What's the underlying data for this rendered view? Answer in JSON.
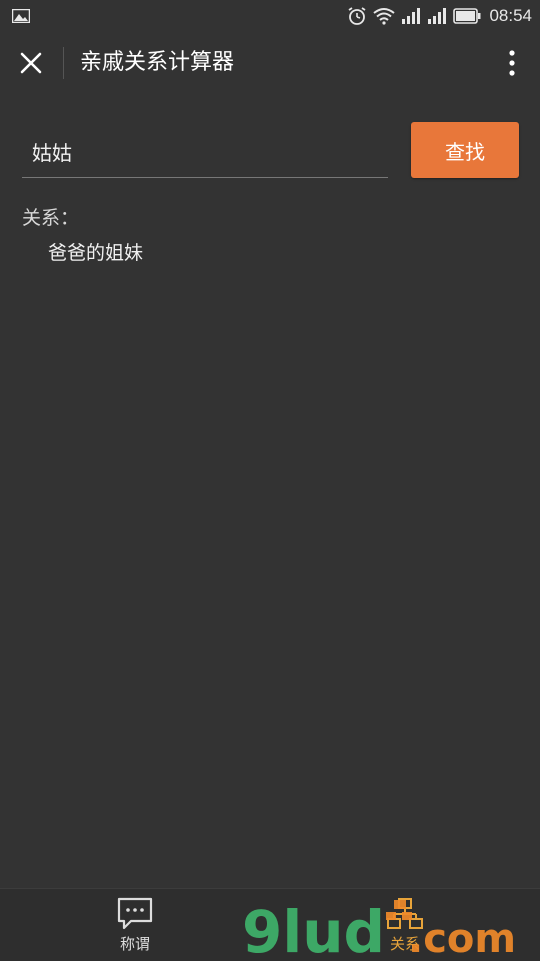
{
  "status_bar": {
    "time": "08:54",
    "icons": [
      "gallery-icon",
      "alarm-icon",
      "wifi-icon",
      "signal-icon",
      "signal-icon",
      "battery-icon"
    ]
  },
  "header": {
    "title": "亲戚关系计算器",
    "close_icon": "close-icon",
    "more_icon": "more-vertical-icon"
  },
  "search": {
    "value": "姑姑",
    "button_label": "查找"
  },
  "result": {
    "label": "关系：",
    "value": "爸爸的姐妹"
  },
  "tabs": [
    {
      "label": "称谓",
      "icon": "chat-icon",
      "active": false
    },
    {
      "label": "关系",
      "icon": "relation-icon",
      "active": true
    }
  ],
  "watermark": {
    "logo_text": "9lud",
    "suffix": ".com"
  },
  "colors": {
    "background": "#333333",
    "accent": "#e8773a",
    "tab_active": "#e8a43a"
  }
}
